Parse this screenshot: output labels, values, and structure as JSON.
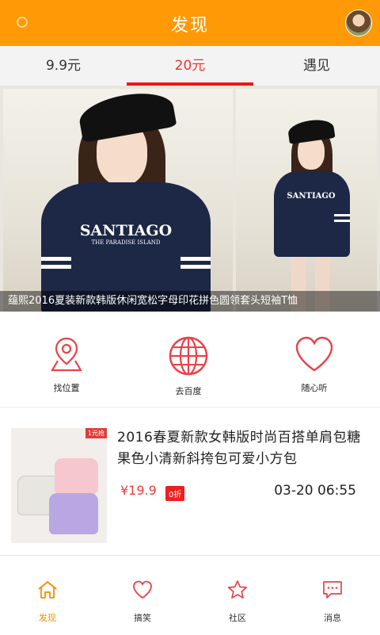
{
  "header": {
    "title": "发现",
    "menu_icon": "circle-menu-icon",
    "avatar_icon": "user-avatar"
  },
  "tabs": [
    {
      "label": "9.9元",
      "active": false
    },
    {
      "label": "20元",
      "active": true
    },
    {
      "label": "遇见",
      "active": false
    }
  ],
  "banner": {
    "caption": "蕴熙2016夏装新款韩版休闲宽松字母印花拼色圆领套头短袖T恤",
    "shirt_text_main": "SANTIAGO",
    "shirt_text_sub": "THE PARADISE ISLAND"
  },
  "quick_links": [
    {
      "label": "找位置",
      "icon": "location-map-icon"
    },
    {
      "label": "去百度",
      "icon": "globe-icon"
    },
    {
      "label": "随心听",
      "icon": "heart-icon"
    }
  ],
  "product": {
    "image_tag": "1元抢",
    "title": "2016春夏新款女韩版时尚百搭单肩包糖果色小清新斜挎包可爱小方包",
    "price": "¥19.9",
    "discount": "0折",
    "time": "03-20 06:55"
  },
  "bottom_nav": [
    {
      "label": "发现",
      "icon": "home-icon",
      "active": true
    },
    {
      "label": "搞笑",
      "icon": "heart-outline-icon",
      "active": false
    },
    {
      "label": "社区",
      "icon": "star-icon",
      "active": false
    },
    {
      "label": "消息",
      "icon": "message-icon",
      "active": false
    }
  ],
  "colors": {
    "header_bg": "#ff9a06",
    "accent_red": "#f01616",
    "active_tab_text": "#f03434",
    "nav_active": "#ff8a00"
  }
}
